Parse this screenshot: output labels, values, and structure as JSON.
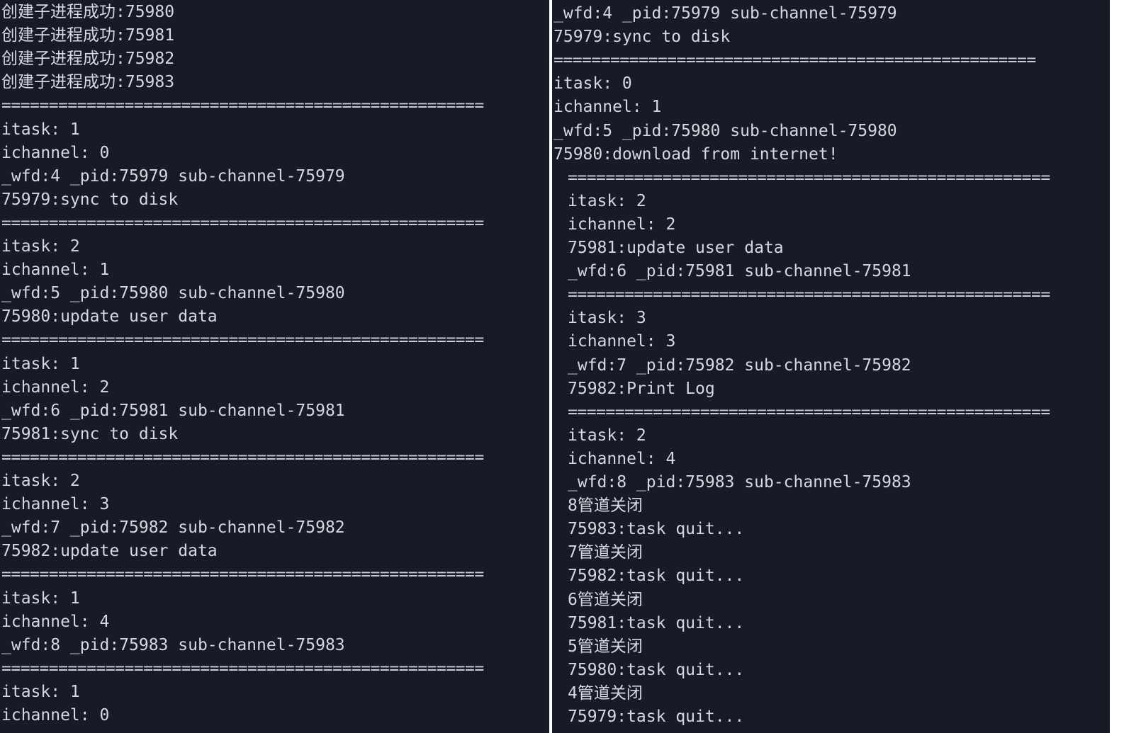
{
  "left_terminal": {
    "lines": [
      "创建子进程成功:75980",
      "创建子进程成功:75981",
      "创建子进程成功:75982",
      "创建子进程成功:75983",
      "===================================================",
      "itask: 1",
      "ichannel: 0",
      "_wfd:4 _pid:75979 sub-channel-75979",
      "75979:sync to disk",
      "===================================================",
      "itask: 2",
      "ichannel: 1",
      "_wfd:5 _pid:75980 sub-channel-75980",
      "75980:update user data",
      "===================================================",
      "itask: 1",
      "ichannel: 2",
      "_wfd:6 _pid:75981 sub-channel-75981",
      "75981:sync to disk",
      "===================================================",
      "itask: 2",
      "ichannel: 3",
      "_wfd:7 _pid:75982 sub-channel-75982",
      "75982:update user data",
      "===================================================",
      "itask: 1",
      "ichannel: 4",
      "_wfd:8 _pid:75983 sub-channel-75983",
      "===================================================",
      "itask: 1",
      "ichannel: 0"
    ]
  },
  "right_terminal": {
    "lines": [
      "_wfd:4 _pid:75979 sub-channel-75979",
      "75979:sync to disk",
      "===================================================",
      "itask: 0",
      "ichannel: 1",
      "_wfd:5 _pid:75980 sub-channel-75980",
      "75980:download from internet!",
      "===================================================",
      "itask: 2",
      "ichannel: 2",
      "75981:update user data",
      "_wfd:6 _pid:75981 sub-channel-75981",
      "===================================================",
      "itask: 3",
      "ichannel: 3",
      "_wfd:7 _pid:75982 sub-channel-75982",
      "75982:Print Log",
      "===================================================",
      "itask: 2",
      "ichannel: 4",
      "_wfd:8 _pid:75983 sub-channel-75983",
      "8管道关闭",
      "75983:task quit...",
      "7管道关闭",
      "75982:task quit...",
      "6管道关闭",
      "75981:task quit...",
      "5管道关闭",
      "75980:task quit...",
      "4管道关闭",
      "75979:task quit..."
    ]
  },
  "colors": {
    "terminal_bg": "#161b26",
    "terminal_fg": "#d4d9e1",
    "divider": "#ffffff"
  }
}
